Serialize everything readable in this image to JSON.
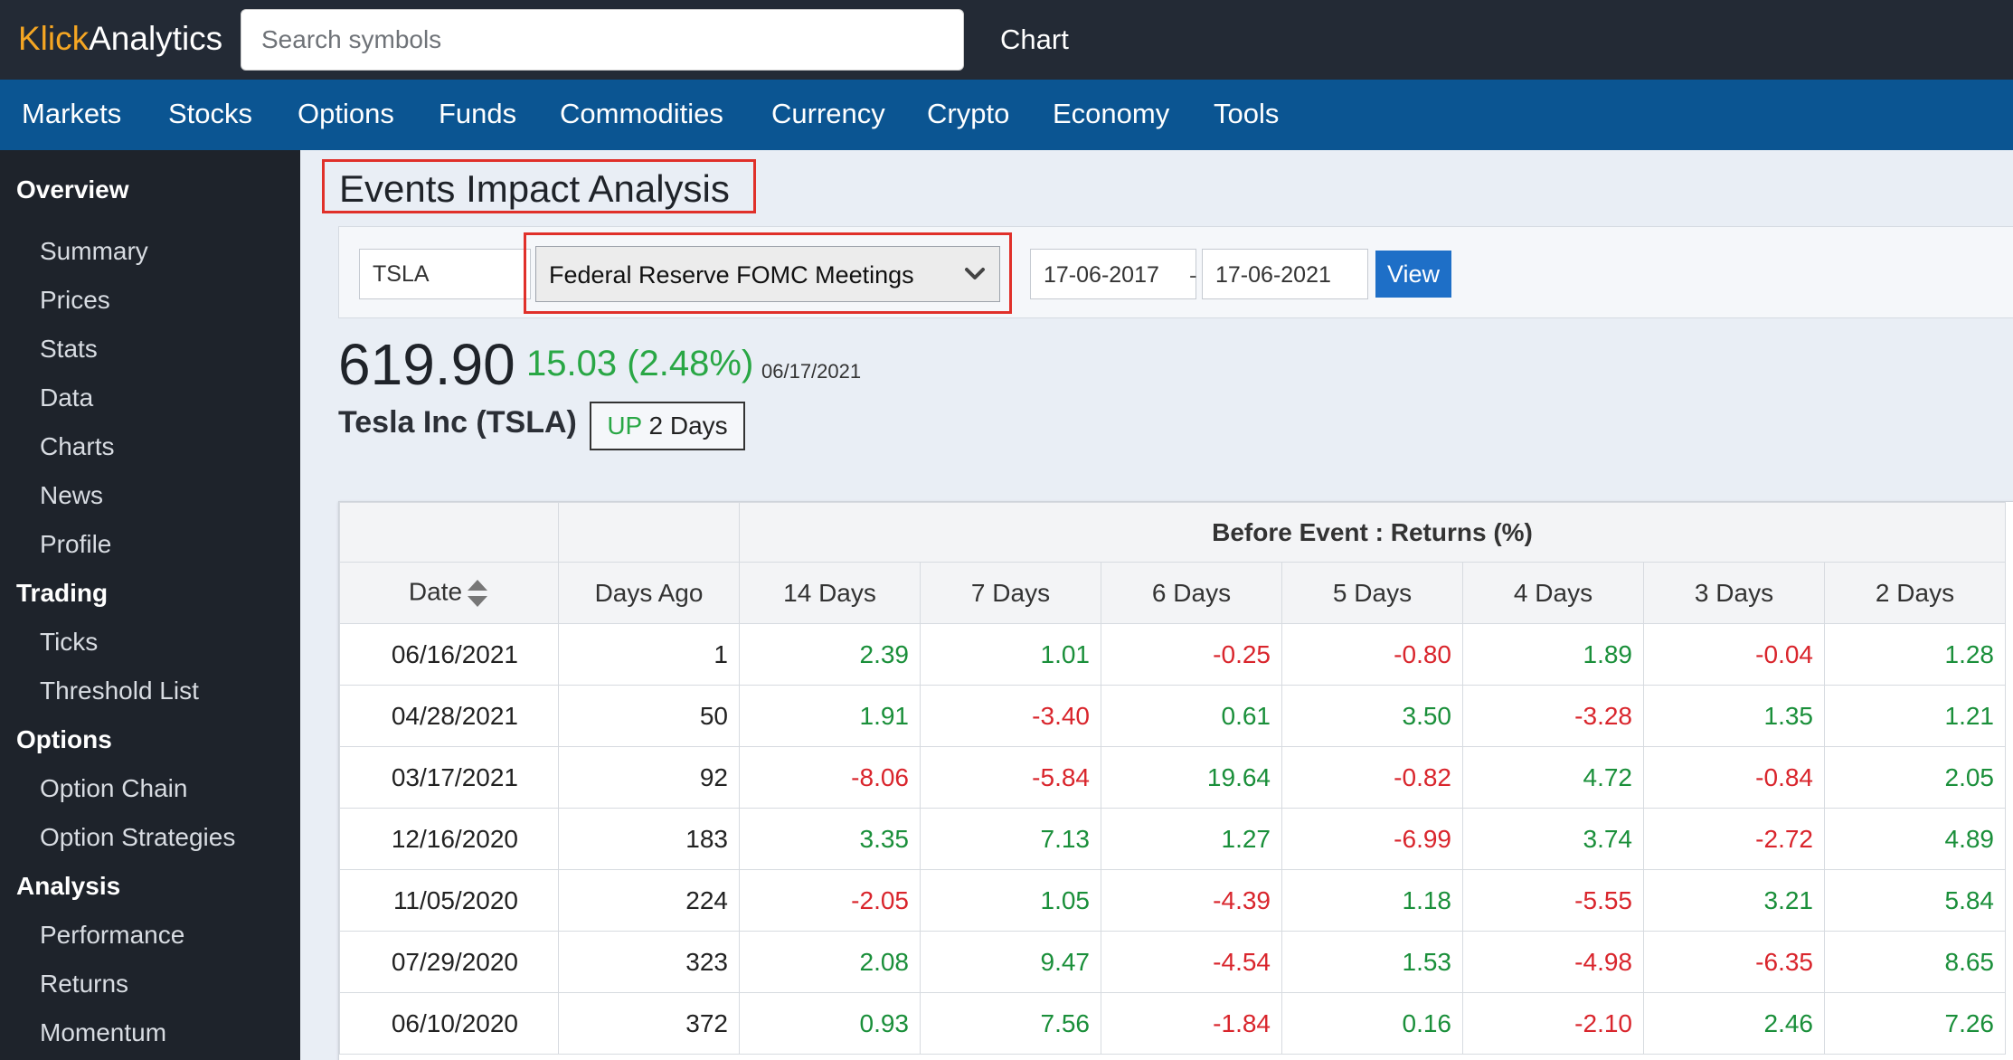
{
  "app": {
    "logo_primary": "Klick",
    "logo_secondary": "Analytics",
    "search_placeholder": "Search symbols",
    "chart_link": "Chart"
  },
  "nav": [
    "Markets",
    "Stocks",
    "Options",
    "Funds",
    "Commodities",
    "Currency",
    "Crypto",
    "Economy",
    "Tools"
  ],
  "sidebar": {
    "sections": [
      {
        "heading": "Overview",
        "items": [
          "Summary",
          "Prices",
          "Stats",
          "Data",
          "Charts",
          "News",
          "Profile"
        ]
      },
      {
        "heading": "Trading",
        "items": [
          "Ticks",
          "Threshold List"
        ]
      },
      {
        "heading": "Options",
        "items": [
          "Option Chain",
          "Option Strategies"
        ]
      },
      {
        "heading": "Analysis",
        "items": [
          "Performance",
          "Returns",
          "Momentum"
        ]
      }
    ]
  },
  "page": {
    "title": "Events Impact Analysis",
    "filters": {
      "symbol": "TSLA",
      "event": "Federal Reserve FOMC Meetings",
      "start_date": "17-06-2017",
      "date_separator": "-",
      "end_date": "17-06-2021",
      "view_label": "View"
    },
    "quote": {
      "price": "619.90",
      "change": "15.03 (2.48%)",
      "as_of": "06/17/2021",
      "company": "Tesla Inc (TSLA)",
      "trend_dir": "UP",
      "trend_len": "2 Days"
    }
  },
  "table": {
    "group_header": "Before Event : Returns (%)",
    "columns": [
      "Date",
      "Days Ago",
      "14 Days",
      "7 Days",
      "6 Days",
      "5 Days",
      "4 Days",
      "3 Days",
      "2 Days"
    ],
    "rows": [
      {
        "date": "06/16/2021",
        "days_ago": "1",
        "returns": [
          "2.39",
          "1.01",
          "-0.25",
          "-0.80",
          "1.89",
          "-0.04",
          "1.28"
        ]
      },
      {
        "date": "04/28/2021",
        "days_ago": "50",
        "returns": [
          "1.91",
          "-3.40",
          "0.61",
          "3.50",
          "-3.28",
          "1.35",
          "1.21"
        ]
      },
      {
        "date": "03/17/2021",
        "days_ago": "92",
        "returns": [
          "-8.06",
          "-5.84",
          "19.64",
          "-0.82",
          "4.72",
          "-0.84",
          "2.05"
        ]
      },
      {
        "date": "12/16/2020",
        "days_ago": "183",
        "returns": [
          "3.35",
          "7.13",
          "1.27",
          "-6.99",
          "3.74",
          "-2.72",
          "4.89"
        ]
      },
      {
        "date": "11/05/2020",
        "days_ago": "224",
        "returns": [
          "-2.05",
          "1.05",
          "-4.39",
          "1.18",
          "-5.55",
          "3.21",
          "5.84"
        ]
      },
      {
        "date": "07/29/2020",
        "days_ago": "323",
        "returns": [
          "2.08",
          "9.47",
          "-4.54",
          "1.53",
          "-4.98",
          "-6.35",
          "8.65"
        ]
      },
      {
        "date": "06/10/2020",
        "days_ago": "372",
        "returns": [
          "0.93",
          "7.56",
          "-1.84",
          "0.16",
          "-2.10",
          "2.46",
          "7.26"
        ]
      }
    ]
  },
  "colors": {
    "positive": "#1a8f3a",
    "negative": "#d9252c",
    "highlight_box": "#e0302a",
    "logo_accent": "#f5a623"
  }
}
